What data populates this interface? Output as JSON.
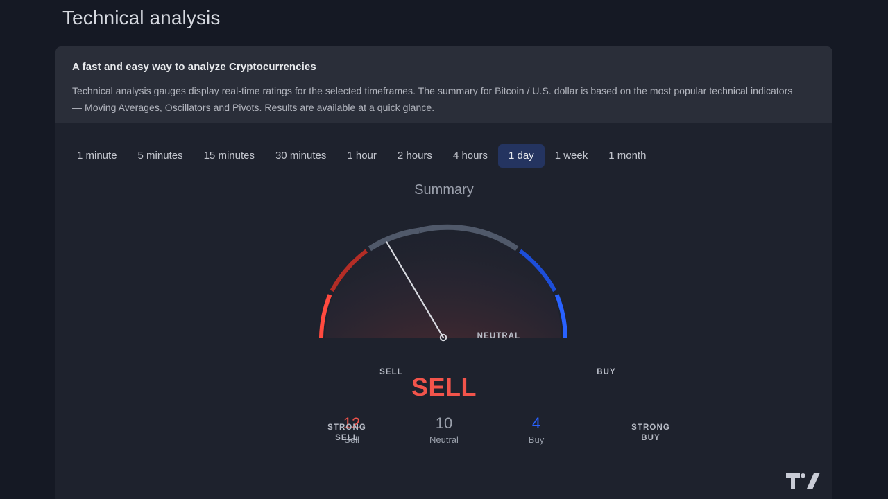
{
  "page": {
    "title": "Technical analysis",
    "background_color": "#151924"
  },
  "widget": {
    "header": {
      "title": "A fast and easy way to analyze Cryptocurrencies",
      "description": "Technical analysis gauges display real-time ratings for the selected timeframes. The summary for Bitcoin / U.S. dollar is based on the most popular technical indicators — Moving Averages, Oscillators and Pivots. Results are available at a quick glance."
    },
    "timeframes": [
      {
        "label": "1 minute",
        "active": false
      },
      {
        "label": "5 minutes",
        "active": false
      },
      {
        "label": "15 minutes",
        "active": false
      },
      {
        "label": "30 minutes",
        "active": false
      },
      {
        "label": "1 hour",
        "active": false
      },
      {
        "label": "2 hours",
        "active": false
      },
      {
        "label": "4 hours",
        "active": false
      },
      {
        "label": "1 day",
        "active": true
      },
      {
        "label": "1 week",
        "active": false
      },
      {
        "label": "1 month",
        "active": false
      }
    ],
    "selected_timeframe": "1 day",
    "gauge": {
      "title": "Summary",
      "labels": {
        "strong_sell": "STRONG\nSELL",
        "sell": "SELL",
        "neutral": "NEUTRAL",
        "buy": "BUY",
        "strong_buy": "STRONG\nBUY"
      },
      "verdict": "SELL",
      "verdict_color": "#f2544b"
    },
    "counts": [
      {
        "value": "12",
        "label": "Sell",
        "color": "#f2544b"
      },
      {
        "value": "10",
        "label": "Neutral",
        "color": "#9aa0ab"
      },
      {
        "value": "4",
        "label": "Buy",
        "color": "#2962ff"
      }
    ],
    "logo": "tradingview-logo"
  },
  "chart_data": {
    "type": "gauge",
    "title": "Summary",
    "categories": [
      "STRONG SELL",
      "SELL",
      "NEUTRAL",
      "BUY",
      "STRONG BUY"
    ],
    "category_colors": [
      "#ff4a3f",
      "#b32d26",
      "#50596a",
      "#1d4ed8",
      "#2962ff"
    ],
    "values": [
      12,
      10,
      4
    ],
    "value_labels": [
      "Sell",
      "Neutral",
      "Buy"
    ],
    "value_colors": [
      "#f2544b",
      "#9aa0ab",
      "#2962ff"
    ],
    "verdict": "SELL",
    "needle_angle_deg": -121,
    "angle_range_deg": [
      -180,
      0
    ],
    "segment_boundaries_deg": [
      -180,
      -144,
      -108,
      -72,
      -36,
      0
    ],
    "timeframe": "1 day",
    "instrument": "Bitcoin / U.S. dollar"
  }
}
